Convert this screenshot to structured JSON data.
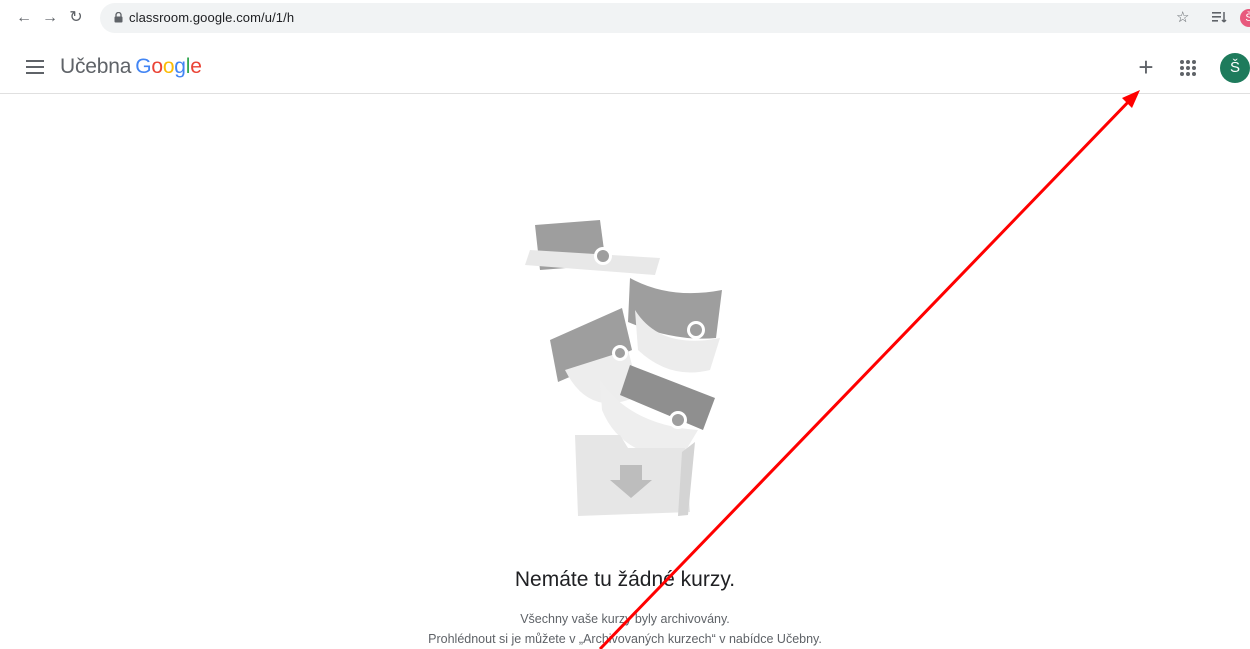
{
  "browser": {
    "url": "classroom.google.com/u/1/h",
    "profile_initial": "Š"
  },
  "app": {
    "title_prefix": "Učebna",
    "title_brand": [
      "G",
      "o",
      "o",
      "g",
      "l",
      "e"
    ],
    "create_label": "+",
    "user_initial": "Š"
  },
  "empty_state": {
    "title": "Nemáte tu žádné kurzy.",
    "line1": "Všechny vaše kurzy byly archivovány.",
    "line2": "Prohlédnout si je můžete v „Archivovaných kurzech“ v nabídce Učebny."
  },
  "colors": {
    "annotation_arrow": "#ff0000",
    "avatar": "#1e7b5c"
  }
}
